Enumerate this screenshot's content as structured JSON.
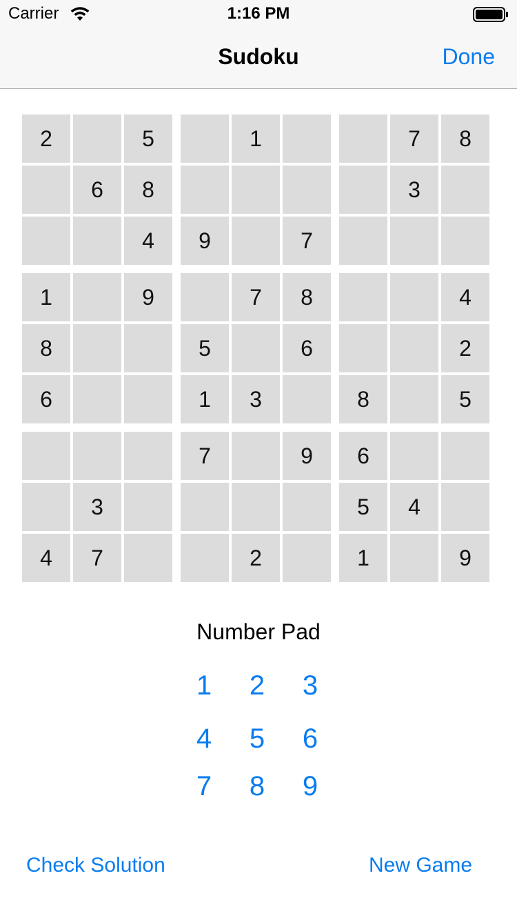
{
  "status_bar": {
    "carrier": "Carrier",
    "time": "1:16 PM",
    "wifi_icon": "wifi-icon",
    "battery_icon": "battery-full-icon"
  },
  "nav": {
    "title": "Sudoku",
    "done_label": "Done"
  },
  "board": {
    "rows": [
      [
        "2",
        "",
        "5",
        "",
        "1",
        "",
        "",
        "7",
        "8"
      ],
      [
        "",
        "6",
        "8",
        "",
        "",
        "",
        "",
        "3",
        ""
      ],
      [
        "",
        "",
        "4",
        "9",
        "",
        "7",
        "",
        "",
        ""
      ],
      [
        "1",
        "",
        "9",
        "",
        "7",
        "8",
        "",
        "",
        "4"
      ],
      [
        "8",
        "",
        "",
        "5",
        "",
        "6",
        "",
        "",
        "2"
      ],
      [
        "6",
        "",
        "",
        "1",
        "3",
        "",
        "8",
        "",
        "5"
      ],
      [
        "",
        "",
        "",
        "7",
        "",
        "9",
        "6",
        "",
        ""
      ],
      [
        "",
        "3",
        "",
        "",
        "",
        "",
        "5",
        "4",
        ""
      ],
      [
        "4",
        "7",
        "",
        "",
        "2",
        "",
        "1",
        "",
        "9"
      ]
    ]
  },
  "number_pad": {
    "title": "Number Pad",
    "keys": [
      "1",
      "2",
      "3",
      "4",
      "5",
      "6",
      "7",
      "8",
      "9"
    ]
  },
  "footer": {
    "check_label": "Check Solution",
    "new_game_label": "New Game"
  },
  "colors": {
    "accent": "#0a7cf0",
    "cell_background": "#dcdcdc",
    "bar_background": "#f7f7f7"
  }
}
